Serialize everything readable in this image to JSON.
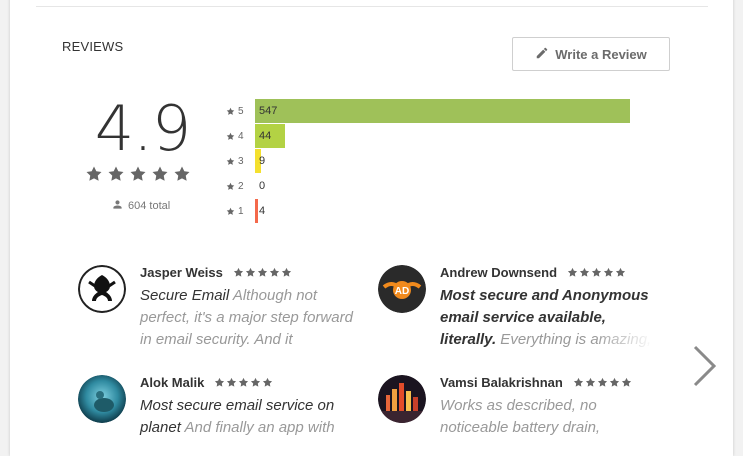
{
  "section": {
    "title": "REVIEWS"
  },
  "write_review": {
    "label": "Write a Review"
  },
  "summary": {
    "score": "4.9",
    "total_text": "604 total"
  },
  "histogram": [
    {
      "star": "5",
      "count": "547",
      "color": "#9fc159"
    },
    {
      "star": "4",
      "count": "44",
      "color": "#b3d244"
    },
    {
      "star": "3",
      "count": "9",
      "color": "#f4e02e"
    },
    {
      "star": "2",
      "count": "0",
      "color": "#f2b13c"
    },
    {
      "star": "1",
      "count": "4",
      "color": "#f4694b"
    }
  ],
  "reviews": [
    {
      "name": "Jasper Weiss",
      "rating": 5,
      "title": "Secure Email",
      "body": " Although not perfect, it's a major step forward in email security. And it"
    },
    {
      "name": "Andrew Downsend",
      "rating": 5,
      "title": "Most secure and Anonymous email service available, literally.",
      "body": " Everything is amazing,"
    },
    {
      "name": "Alok Malik",
      "rating": 5,
      "title": "Most secure email service on planet",
      "body": " And finally an app with"
    },
    {
      "name": "Vamsi Balakrishnan",
      "rating": 5,
      "title": "",
      "body": "Works as described, no noticeable battery drain,"
    }
  ],
  "colors": {
    "accent_green": "#9fc159",
    "star_gray": "#666666"
  },
  "icons": {
    "write": "pencil-icon",
    "person": "person-icon",
    "star": "star-icon",
    "next": "chevron-right-icon"
  }
}
